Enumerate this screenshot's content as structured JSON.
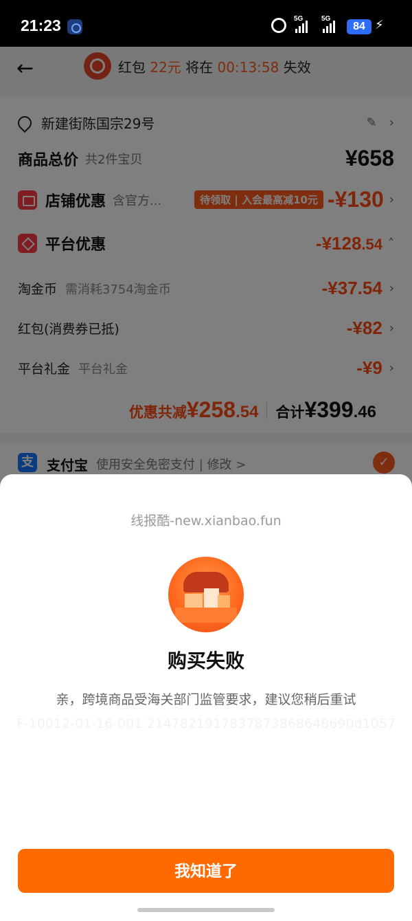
{
  "status_bar": {
    "time": "21:23",
    "sig1_label": "5G",
    "sig2_label": "5G",
    "battery": "84"
  },
  "header": {
    "back_icon": "arrow-left-icon",
    "timer_prefix": "红包",
    "timer_amount": "22元",
    "timer_mid": "将在",
    "timer_countdown": "00:13:58",
    "timer_suffix": "失效"
  },
  "order": {
    "address": "新建街陈国宗29号",
    "total_label": "商品总价",
    "total_count": "共2件宝贝",
    "total_price": "¥658",
    "shop_discount_label": "店铺优惠",
    "shop_discount_note": "含官方...",
    "shop_discount_badge": "待领取 | 入会最高减10元",
    "shop_discount_value": "-¥130",
    "platform_discount_label": "平台优惠",
    "platform_discount_int": "-¥128",
    "platform_discount_dec": ".54",
    "items": [
      {
        "label": "淘金币",
        "note": "需消耗3754淘金币",
        "value": "-¥37.54"
      },
      {
        "label": "红包(消费券已抵)",
        "note": "",
        "value": "-¥82"
      },
      {
        "label": "平台礼金",
        "note": "平台礼金",
        "value": "-¥9"
      }
    ],
    "saved_label": "优惠共减",
    "saved_int": "¥258",
    "saved_dec": ".54",
    "sum_label": "合计",
    "sum_int": "¥399",
    "sum_dec": ".46"
  },
  "payment": {
    "icon_glyph": "支",
    "name": "支付宝",
    "desc": "使用安全免密支付 | 修改 >"
  },
  "dialog": {
    "watermark": "线报酷-new.xianbao.fun",
    "title": "购买失败",
    "message": "亲，跨境商品受海关部门监管要求，建议您稍后重试",
    "trace_id": "F-10012-01-16-001 2147821917837873868648690d1057",
    "button_label": "我知道了"
  },
  "colors": {
    "accent": "#ff6a00",
    "price_red": "#ff4a12",
    "alipay_blue": "#1677ff"
  }
}
